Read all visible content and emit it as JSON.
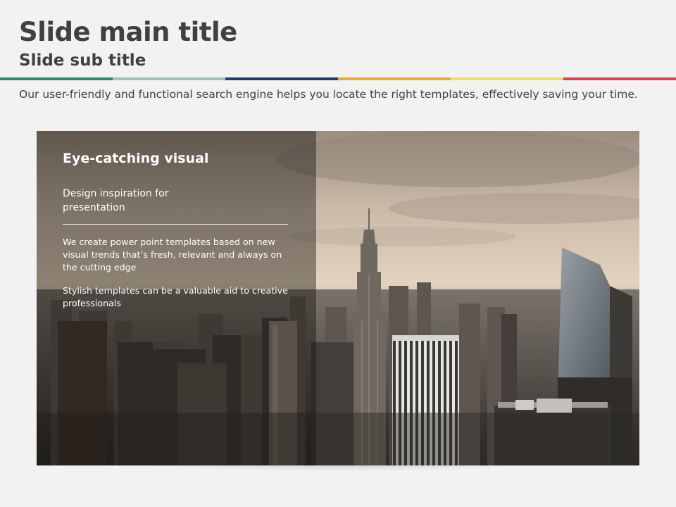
{
  "slide": {
    "title": "Slide main title",
    "subtitle": "Slide sub title",
    "body": "Our user-friendly and functional search engine helps you locate the right templates, effectively saving your time."
  },
  "color_bar": [
    "#2e8b6e",
    "#9cc5b3",
    "#1f3d6b",
    "#e7a941",
    "#f4dc6e",
    "#d2474d"
  ],
  "photo": {
    "overlay": {
      "title": "Eye-catching visual",
      "subtitle": "Design inspiration for presentation",
      "paragraph1": "We create power point templates based on new visual trends that’s fresh, relevant and always on the cutting edge",
      "paragraph2": "Stylish templates can be a valuable aid to creative professionals"
    }
  },
  "colors": {
    "background": "#f2f2f2",
    "text": "#404040",
    "overlay_text": "#ffffff"
  }
}
